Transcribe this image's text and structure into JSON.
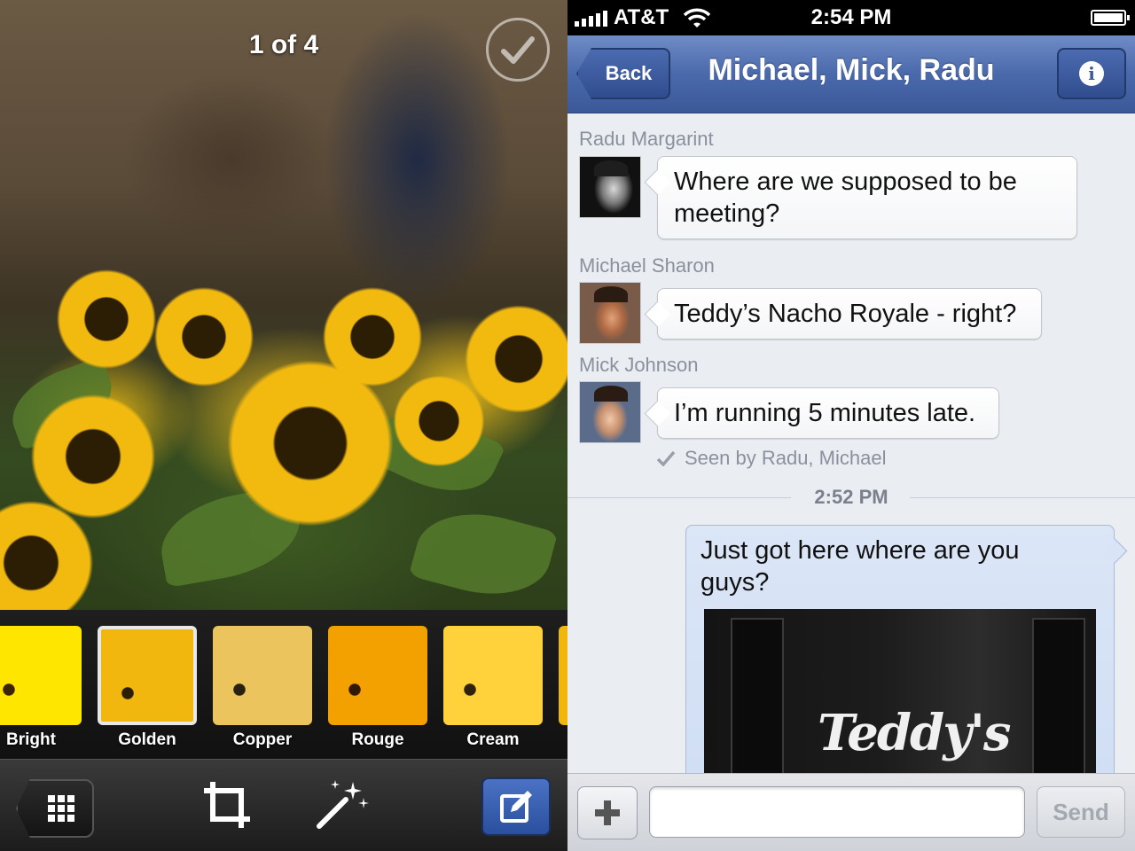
{
  "photo_editor": {
    "counter": "1 of 4",
    "filters": [
      {
        "label": "Bright"
      },
      {
        "label": "Golden"
      },
      {
        "label": "Copper"
      },
      {
        "label": "Rouge"
      },
      {
        "label": "Cream"
      }
    ],
    "selected_filter": "Golden",
    "toolbar_icons": [
      "grid-icon",
      "crop-icon",
      "magic-wand-icon",
      "edit-icon"
    ]
  },
  "status_bar": {
    "carrier": "AT&T",
    "time": "2:54 PM"
  },
  "conversation": {
    "back_label": "Back",
    "title": "Michael, Mick, Radu",
    "info_icon": "i",
    "messages": [
      {
        "sender": "Radu Margarint",
        "text": "Where are we supposed to be meeting?"
      },
      {
        "sender": "Michael Sharon",
        "text": "Teddy’s Nacho Royale - right?"
      },
      {
        "sender": "Mick Johnson",
        "text": "I’m running 5 minutes late."
      }
    ],
    "seen_by": "Seen by Radu, Michael",
    "time_separator": "2:52 PM",
    "outgoing": {
      "text": "Just got here where are you guys?",
      "photo_sign": "Teddy's"
    },
    "composer": {
      "plus_label": "+",
      "input_value": "",
      "send_label": "Send"
    }
  },
  "colors": {
    "facebook_blue": "#3b5998",
    "edit_button_blue": "#2a4f9e",
    "sunflower_yellow": "#f2b90f"
  }
}
